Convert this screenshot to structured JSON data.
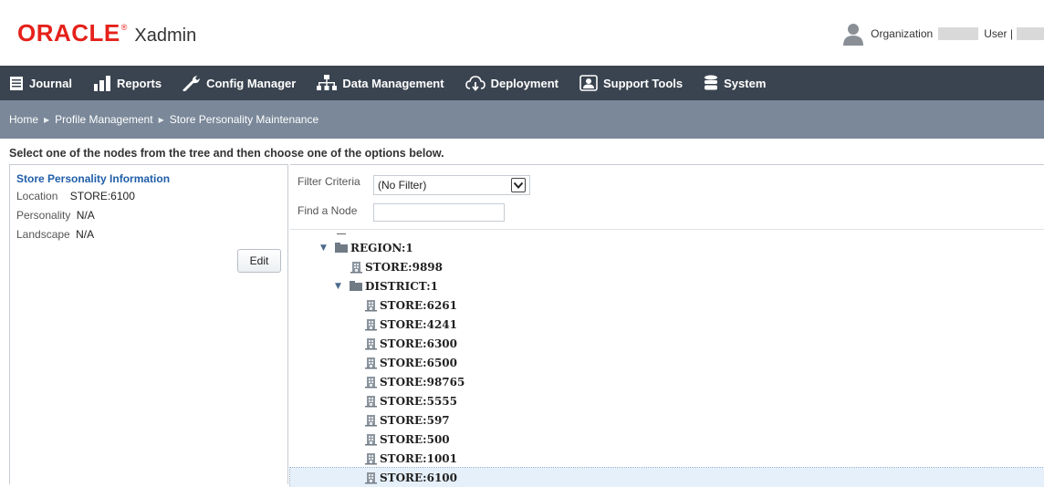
{
  "header": {
    "brand": "ORACLE",
    "brand_mark": "®",
    "app_name": "Xadmin",
    "organization_label": "Organization",
    "user_label": "User |"
  },
  "nav": {
    "items": [
      {
        "label": "Journal",
        "icon": "journal-icon"
      },
      {
        "label": "Reports",
        "icon": "reports-icon"
      },
      {
        "label": "Config Manager",
        "icon": "wrench-icon"
      },
      {
        "label": "Data Management",
        "icon": "hierarchy-icon"
      },
      {
        "label": "Deployment",
        "icon": "cloud-download-icon"
      },
      {
        "label": "Support Tools",
        "icon": "support-icon"
      },
      {
        "label": "System",
        "icon": "database-icon"
      }
    ]
  },
  "breadcrumb": [
    "Home",
    "Profile Management",
    "Store Personality Maintenance"
  ],
  "instructions": "Select one of the nodes from the tree and then choose one of the options below.",
  "info_panel": {
    "title": "Store Personality Information",
    "location_label": "Location",
    "location_value": "STORE:6100",
    "personality_label": "Personality",
    "personality_value": "N/A",
    "landscape_label": "Landscape",
    "landscape_value": "N/A",
    "edit_label": "Edit"
  },
  "filter": {
    "label": "Filter Criteria",
    "selected": "(No Filter)",
    "find_label": "Find a Node",
    "find_value": ""
  },
  "tree": {
    "region": "REGION:1",
    "region_store": "STORE:9898",
    "district": "DISTRICT:1",
    "stores": [
      "STORE:6261",
      "STORE:4241",
      "STORE:6300",
      "STORE:6500",
      "STORE:98765",
      "STORE:5555",
      "STORE:597",
      "STORE:500",
      "STORE:1001",
      "STORE:6100"
    ],
    "selected": "STORE:6100"
  },
  "colors": {
    "brand_red": "#e5211a",
    "nav_bg": "#3a4450",
    "breadcrumb_bg": "#7a8899",
    "title_blue": "#1f5ea8"
  }
}
